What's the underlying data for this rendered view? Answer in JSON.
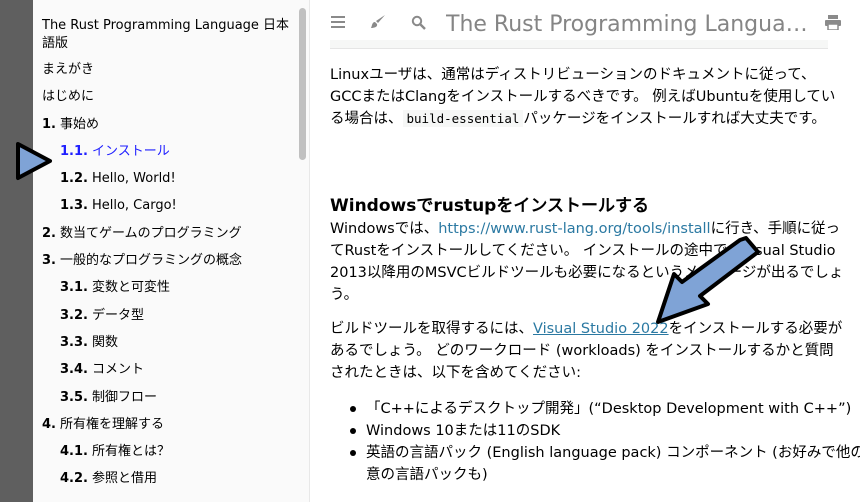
{
  "sidebar": {
    "items": [
      {
        "num": "",
        "label": "The Rust Programming Language 日本語版",
        "level": 0,
        "wrap": true
      },
      {
        "num": "",
        "label": "まえがき",
        "level": 0
      },
      {
        "num": "",
        "label": "はじめに",
        "level": 0
      },
      {
        "num": "1.",
        "label": "事始め",
        "level": 0
      },
      {
        "num": "1.1.",
        "label": "インストール",
        "level": 1,
        "active": true
      },
      {
        "num": "1.2.",
        "label": "Hello, World!",
        "level": 1
      },
      {
        "num": "1.3.",
        "label": "Hello, Cargo!",
        "level": 1
      },
      {
        "num": "2.",
        "label": "数当てゲームのプログラミング",
        "level": 0
      },
      {
        "num": "3.",
        "label": "一般的なプログラミングの概念",
        "level": 0
      },
      {
        "num": "3.1.",
        "label": "変数と可変性",
        "level": 1
      },
      {
        "num": "3.2.",
        "label": "データ型",
        "level": 1
      },
      {
        "num": "3.3.",
        "label": "関数",
        "level": 1
      },
      {
        "num": "3.4.",
        "label": "コメント",
        "level": 1
      },
      {
        "num": "3.5.",
        "label": "制御フロー",
        "level": 1
      },
      {
        "num": "4.",
        "label": "所有権を理解する",
        "level": 0
      },
      {
        "num": "4.1.",
        "label": "所有権とは？",
        "level": 1
      },
      {
        "num": "4.2.",
        "label": "参照と借用",
        "level": 1
      }
    ]
  },
  "topbar": {
    "title": "The Rust Programming Language 日本語版",
    "icons": [
      "menu-icon",
      "paintbrush-icon",
      "search-icon",
      "print-icon"
    ]
  },
  "content": {
    "p1_text": "Linuxユーザは、通常はディストリビューションのドキュメントに従って、GCCまたはClangをインストールするべきです。 例えばUbuntuを使用している場合は、",
    "p1_code": "build-essential",
    "p1_end": "パッケージをインストールすれば大丈夫です。",
    "heading": "Windowsでrustupをインストールする",
    "p2_start": "Windowsでは、",
    "p2_link": "https://www.rust-lang.org/tools/install",
    "p2_end": "に行き、手順に従ってRustをインストールしてください。 インストールの途中で、Visual Studio 2013以降用のMSVCビルドツールも必要になるというメッセージが出るでしょう。",
    "p3_start": "ビルドツールを取得するには、",
    "p3_link": "Visual Studio 2022",
    "p3_end": "をインストールする必要があるでしょう。 どのワークロード (workloads) をインストールするかと質問されたときは、以下を含めてください:",
    "bullets": [
      "「C++によるデスクトップ開発」(“Desktop Development with C++”)",
      "Windows 10または11のSDK",
      "英語の言語パック (English language pack) コンポーネント (お好みで他の任意の言語パックも)"
    ]
  },
  "colors": {
    "link": "#2b79a2",
    "active": "#1f1fff",
    "annotation_arrow": "#7fa3d6"
  }
}
